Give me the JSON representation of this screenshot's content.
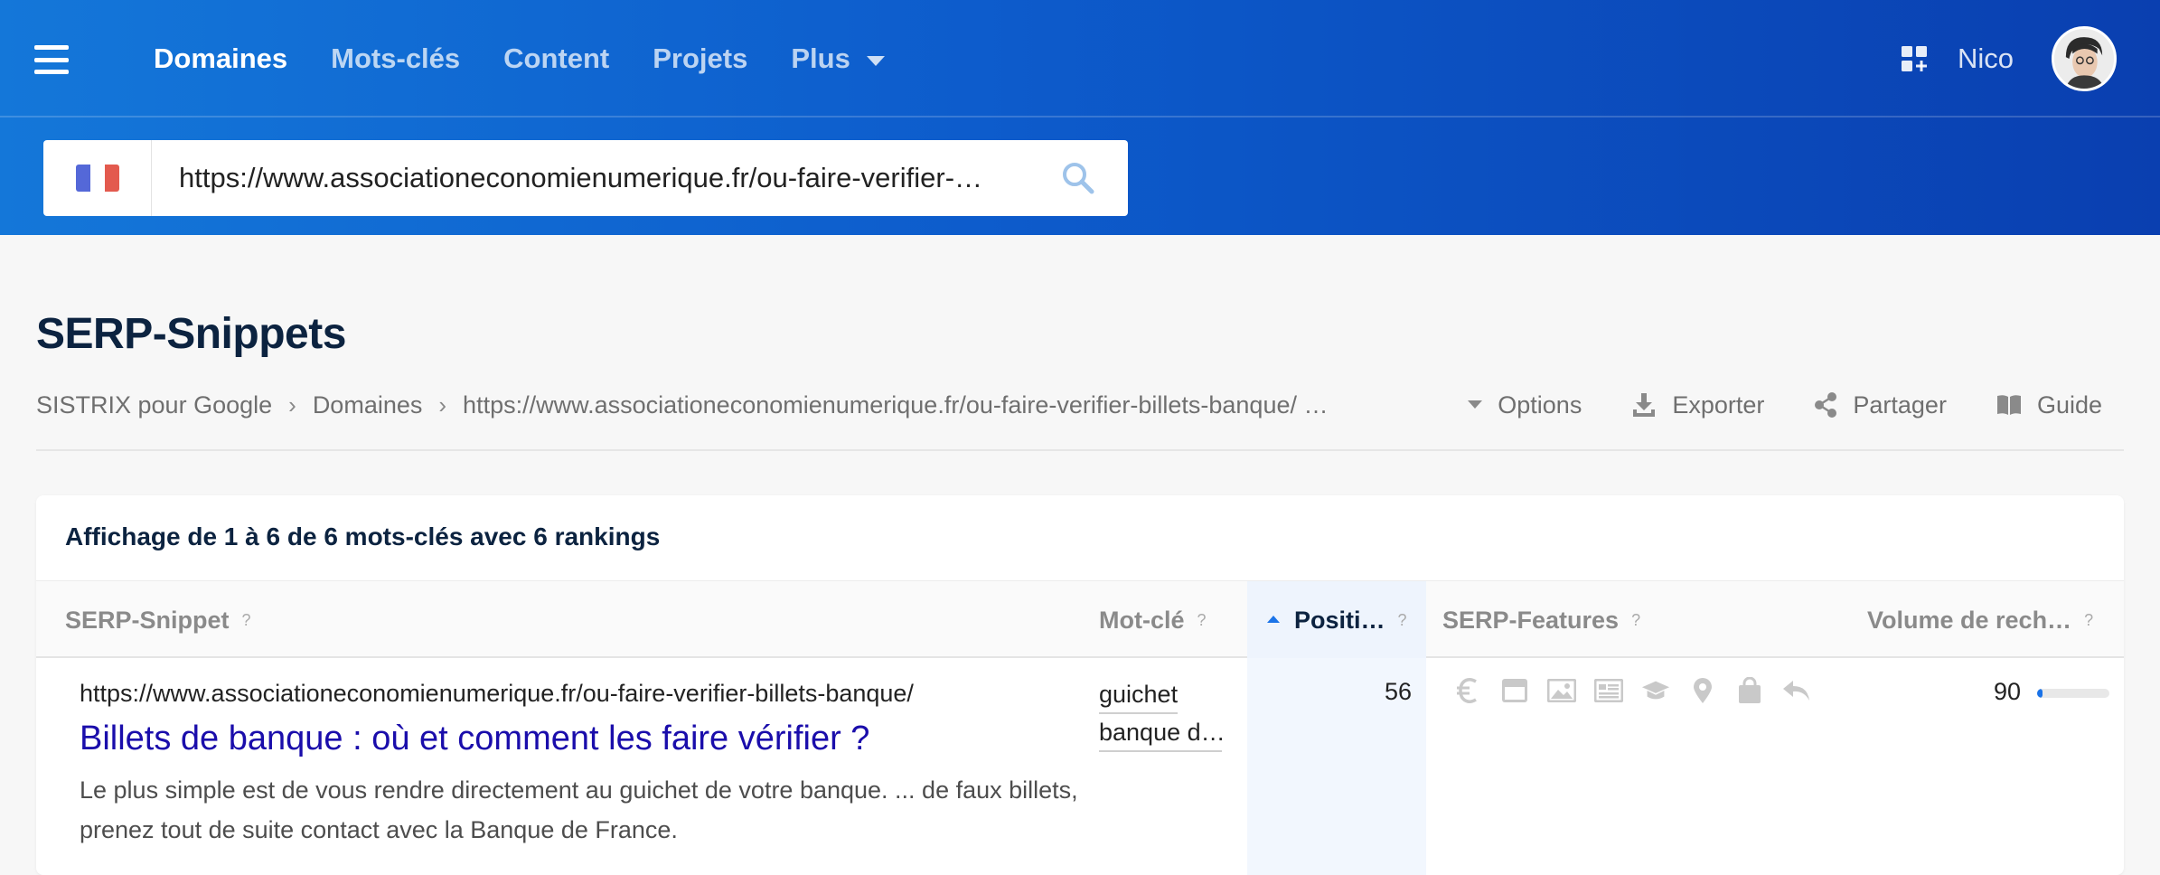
{
  "nav": {
    "items": [
      {
        "label": "Domaines",
        "active": true
      },
      {
        "label": "Mots-clés",
        "active": false
      },
      {
        "label": "Content",
        "active": false
      },
      {
        "label": "Projets",
        "active": false
      },
      {
        "label": "Plus",
        "active": false
      }
    ],
    "user_name": "Nico",
    "icons": [
      "menu-icon",
      "apps-icon",
      "avatar"
    ]
  },
  "search": {
    "country": "France",
    "value": "https://www.associationeconomienumerique.fr/ou-faire-verifier-…"
  },
  "page": {
    "title": "SERP-Snippets",
    "breadcrumb": [
      "SISTRIX pour Google",
      "Domaines",
      "https://www.associationeconomienumerique.fr/ou-faire-verifier-billets-banque/ …"
    ],
    "actions": {
      "options": "Options",
      "export": "Exporter",
      "share": "Partager",
      "guide": "Guide"
    }
  },
  "table": {
    "summary": "Affichage de 1 à 6 de 6 mots-clés avec 6 rankings",
    "columns": {
      "snippet": "SERP-Snippet",
      "keyword": "Mot-clé",
      "position": "Positi…",
      "features": "SERP-Features",
      "volume": "Volume de rech…",
      "help": "?"
    },
    "rows": [
      {
        "url": "https://www.associationeconomienumerique.fr/ou-faire-verifier-billets-banque/",
        "title": "Billets de banque : où et comment les faire vérifier ?",
        "description": "Le plus simple est de vous rendre directement au guichet de votre banque. ... de faux billets, prenez tout de suite contact avec la Banque de France.",
        "keyword_line1": "guichet",
        "keyword_line2": "banque d…",
        "position": "56",
        "volume": "90",
        "volume_fraction": 0.08,
        "features": [
          "euro-icon",
          "card-icon",
          "image-icon",
          "news-icon",
          "education-icon",
          "location-icon",
          "shopping-icon",
          "reply-icon"
        ]
      }
    ]
  },
  "colors": {
    "header_start": "#1477d9",
    "header_end": "#0a3fb0",
    "title_dark": "#0c2340",
    "snippet_link": "#1a0dab",
    "accent": "#1a73e8"
  }
}
